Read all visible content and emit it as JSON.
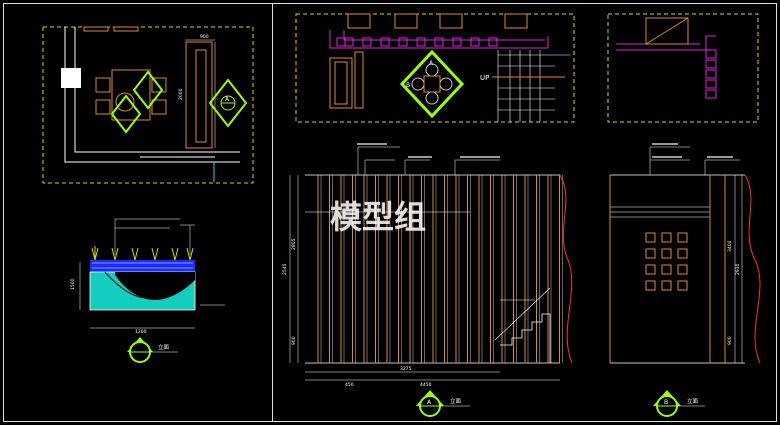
{
  "watermark": "模型组",
  "stair_label": "UP",
  "marker_a_letter": "A",
  "marker_b_letter": "B",
  "view_a_title": "立面",
  "view_b_title": "立面",
  "section_title": "立面",
  "colors": {
    "background": "#000000",
    "frame": "#e0e0e0",
    "yellow_dash": "#d8d800",
    "magenta": "#e020e0",
    "orange": "#e08a2c",
    "green": "#9cff00",
    "water": "#14d8c8",
    "blue_band": "#1a2cff",
    "red_curve": "#ff3030",
    "dim_white": "#ffffff"
  },
  "dims": {
    "plan_top_label": "900",
    "plan_side_label": "2000",
    "section_width": "1200",
    "section_height": "1500",
    "elev_a_total": "4450",
    "elev_a_part": "3275",
    "elev_a_small": "450",
    "elev_a_left_h": "2805",
    "elev_a_left_total": "2545",
    "elev_a_base": "900",
    "elev_b_h": "3400",
    "elev_b_total": "2930",
    "elev_b_base": "900"
  }
}
